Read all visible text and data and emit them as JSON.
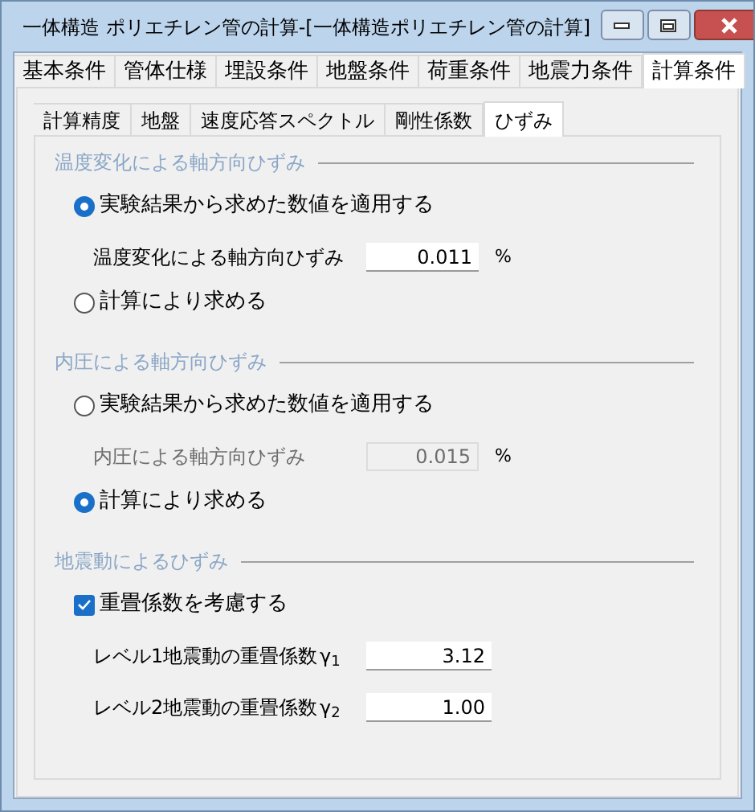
{
  "window": {
    "title": "一体構造 ポリエチレン管の計算-[一体構造ポリエチレン管の計算]"
  },
  "tabs": [
    {
      "label": "基本条件",
      "selected": false
    },
    {
      "label": "管体仕様",
      "selected": false
    },
    {
      "label": "埋設条件",
      "selected": false
    },
    {
      "label": "地盤条件",
      "selected": false
    },
    {
      "label": "荷重条件",
      "selected": false
    },
    {
      "label": "地震力条件",
      "selected": false
    },
    {
      "label": "計算条件",
      "selected": true
    }
  ],
  "subtabs": [
    {
      "label": "計算精度",
      "selected": false
    },
    {
      "label": "地盤",
      "selected": false
    },
    {
      "label": "速度応答スペクトル",
      "selected": false
    },
    {
      "label": "剛性係数",
      "selected": false
    },
    {
      "label": "ひずみ",
      "selected": true
    }
  ],
  "sections": [
    {
      "title": "温度変化による軸方向ひずみ",
      "items": [
        {
          "kind": "radio",
          "label": "実験結果から求めた数値を適用する",
          "selected": true
        },
        {
          "kind": "field",
          "label": "温度変化による軸方向ひずみ",
          "value": "0.011",
          "unit": "%",
          "disabled": false
        },
        {
          "kind": "radio",
          "label": "計算により求める",
          "selected": false
        }
      ]
    },
    {
      "title": "内圧による軸方向ひずみ",
      "items": [
        {
          "kind": "radio",
          "label": "実験結果から求めた数値を適用する",
          "selected": false
        },
        {
          "kind": "field",
          "label": "内圧による軸方向ひずみ",
          "value": "0.015",
          "unit": "%",
          "disabled": true
        },
        {
          "kind": "radio",
          "label": "計算により求める",
          "selected": true
        }
      ]
    },
    {
      "title": "地震動によるひずみ",
      "items": [
        {
          "kind": "checkbox",
          "label": "重畳係数を考慮する",
          "checked": true
        },
        {
          "kind": "coefficient",
          "label": "レベル1地震動の重畳係数",
          "symbol": "γ$_{1}$",
          "value": "3.12"
        },
        {
          "kind": "coefficient",
          "label": "レベル2地震動の重畳係数",
          "symbol": "γ$_{2}$",
          "value": "1.00"
        }
      ]
    }
  ]
}
